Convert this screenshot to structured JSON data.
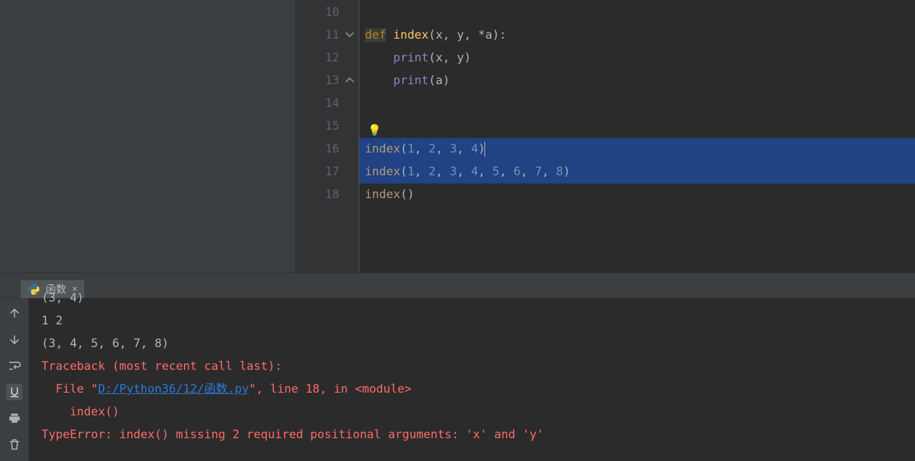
{
  "editor": {
    "first_line_number": 10,
    "lines": [
      {
        "n": 10,
        "html": ""
      },
      {
        "n": 11,
        "fold": "open",
        "html": "<span class=\"kw def-hl\">def</span> <span class=\"fn\">index</span><span class=\"pn\">(x, y, *a):</span>"
      },
      {
        "n": 12,
        "html": "    <span class=\"builtin\">print</span><span class=\"pn\">(x, y)</span>"
      },
      {
        "n": 13,
        "fold": "close",
        "html": "    <span class=\"builtin\">print</span><span class=\"pn\">(a)</span>"
      },
      {
        "n": 14,
        "html": ""
      },
      {
        "n": 15,
        "bulb": true,
        "html": ""
      },
      {
        "n": 16,
        "selected": true,
        "caret": true,
        "html": "<span class=\"call\">index</span><span class=\"pn\">(</span><span class=\"num\">1</span><span class=\"pn\">, </span><span class=\"num\">2</span><span class=\"pn\">, </span><span class=\"num\">3</span><span class=\"pn\">, </span><span class=\"num\">4</span><span class=\"pn\">)</span>"
      },
      {
        "n": 17,
        "selected": true,
        "html": "<span class=\"call\">index</span><span class=\"pn\">(</span><span class=\"num\">1</span><span class=\"pn\">, </span><span class=\"num\">2</span><span class=\"pn\">, </span><span class=\"num\">3</span><span class=\"pn\">, </span><span class=\"num\">4</span><span class=\"pn\">, </span><span class=\"num\">5</span><span class=\"pn\">, </span><span class=\"num\">6</span><span class=\"pn\">, </span><span class=\"num\">7</span><span class=\"pn\">, </span><span class=\"num\">8</span><span class=\"pn\">)</span>"
      },
      {
        "n": 18,
        "html": "<span class=\"call\">index</span><span class=\"pn\">()</span>"
      }
    ]
  },
  "run_tab": {
    "label": "函数",
    "close_glyph": "×"
  },
  "console": {
    "lines": [
      {
        "cls": "",
        "text": "(3, 4)"
      },
      {
        "cls": "",
        "text": "1 2"
      },
      {
        "cls": "",
        "text": "(3, 4, 5, 6, 7, 8)"
      },
      {
        "cls": "err",
        "html": "Traceback (most recent call last):"
      },
      {
        "cls": "err",
        "html": "  File \"<span class=\"link\">D:/Python36/12/函数.py</span>\", line 18, in &lt;module&gt;"
      },
      {
        "cls": "err",
        "html": "    index()"
      },
      {
        "cls": "err",
        "html": "TypeError: index() missing 2 required positional arguments: 'x' and 'y'"
      }
    ]
  },
  "toolbar": {
    "up": "↑",
    "down": "↓",
    "wrap": "↩",
    "export": "⭳",
    "print": "⎙",
    "trash": "🗑"
  }
}
